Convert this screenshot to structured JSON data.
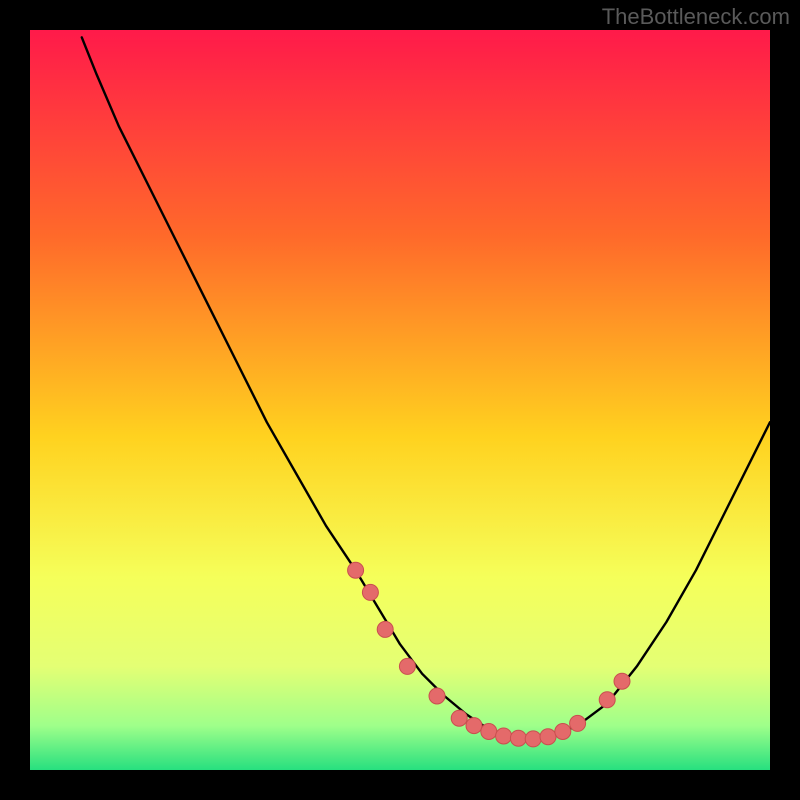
{
  "watermark": "TheBottleneck.com",
  "colors": {
    "frame": "#000000",
    "grad_top": "#ff1a4a",
    "grad_mid1": "#ff6a2a",
    "grad_mid2": "#ffd21f",
    "grad_mid3": "#f5ff5a",
    "grad_bottom1": "#e4ff74",
    "grad_bottom2": "#9fff8a",
    "grad_bottom3": "#27e07f",
    "curve": "#000000",
    "marker_fill": "#e46a6a",
    "marker_stroke": "#c94f4f"
  },
  "chart_data": {
    "type": "line",
    "title": "",
    "xlabel": "",
    "ylabel": "",
    "xlim": [
      0,
      100
    ],
    "ylim": [
      0,
      100
    ],
    "series": [
      {
        "name": "bottleneck-curve",
        "x": [
          7,
          9,
          12,
          16,
          20,
          24,
          28,
          32,
          36,
          40,
          44,
          47,
          50,
          53,
          56,
          59,
          62,
          65,
          68,
          71,
          74,
          78,
          82,
          86,
          90,
          94,
          98,
          100
        ],
        "y": [
          99,
          94,
          87,
          79,
          71,
          63,
          55,
          47,
          40,
          33,
          27,
          22,
          17,
          13,
          10,
          7.5,
          5.5,
          4.5,
          4.2,
          4.8,
          6,
          9,
          14,
          20,
          27,
          35,
          43,
          47
        ]
      }
    ],
    "markers": {
      "name": "highlight-points",
      "x": [
        44,
        46,
        48,
        51,
        55,
        58,
        60,
        62,
        64,
        66,
        68,
        70,
        72,
        74,
        78,
        80
      ],
      "y": [
        27,
        24,
        19,
        14,
        10,
        7,
        6,
        5.2,
        4.6,
        4.3,
        4.2,
        4.5,
        5.2,
        6.3,
        9.5,
        12
      ]
    }
  }
}
